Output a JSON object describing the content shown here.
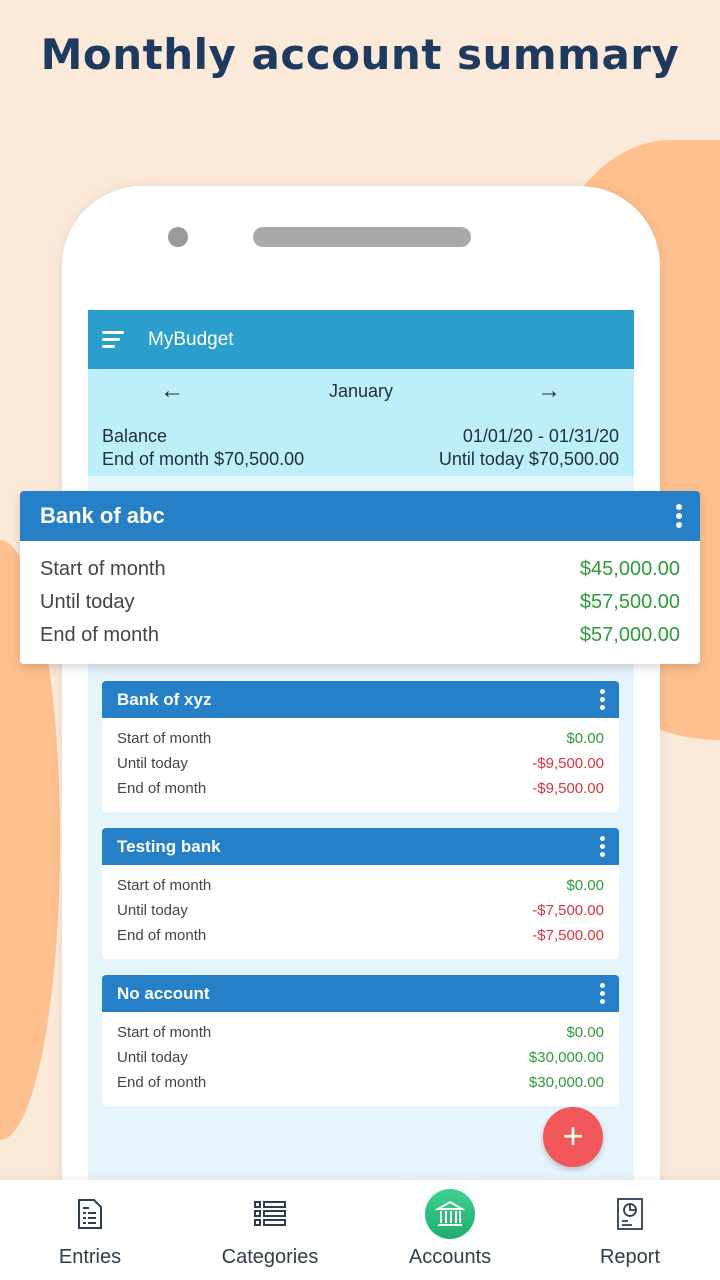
{
  "headline": "Monthly account summary",
  "app": {
    "title": "MyBudget"
  },
  "period": {
    "month": "January",
    "balance_label": "Balance",
    "end_of_month": "End of month $70,500.00",
    "range": "01/01/20 - 01/31/20",
    "until_today": "Until today $70,500.00"
  },
  "accounts": [
    {
      "name": "Bank of abc",
      "rows": [
        {
          "label": "Start of month",
          "value": "$45,000.00"
        },
        {
          "label": "Until today",
          "value": "$57,500.00"
        },
        {
          "label": "End of month",
          "value": "$57,000.00"
        }
      ]
    },
    {
      "name": "Bank of xyz",
      "rows": [
        {
          "label": "Start of month",
          "value": "$0.00"
        },
        {
          "label": "Until today",
          "value": "-$9,500.00"
        },
        {
          "label": "End of month",
          "value": "-$9,500.00"
        }
      ]
    },
    {
      "name": "Testing bank",
      "rows": [
        {
          "label": "Start of month",
          "value": "$0.00"
        },
        {
          "label": "Until today",
          "value": "-$7,500.00"
        },
        {
          "label": "End of month",
          "value": "-$7,500.00"
        }
      ]
    },
    {
      "name": "No account",
      "rows": [
        {
          "label": "Start of month",
          "value": "$0.00"
        },
        {
          "label": "Until today",
          "value": "$30,000.00"
        },
        {
          "label": "End of month",
          "value": "$30,000.00"
        }
      ]
    }
  ],
  "fab": "+",
  "nav": [
    {
      "label": "Entries",
      "icon": "document-icon"
    },
    {
      "label": "Categories",
      "icon": "list-icon"
    },
    {
      "label": "Accounts",
      "icon": "bank-icon",
      "active": true
    },
    {
      "label": "Report",
      "icon": "report-icon"
    }
  ],
  "colors": {
    "primary": "#2a9fcc",
    "card_header": "#2580c8",
    "positive": "#2e9b3a",
    "negative": "#d9343d",
    "active": "#2fc07d",
    "fab": "#f2575a"
  }
}
